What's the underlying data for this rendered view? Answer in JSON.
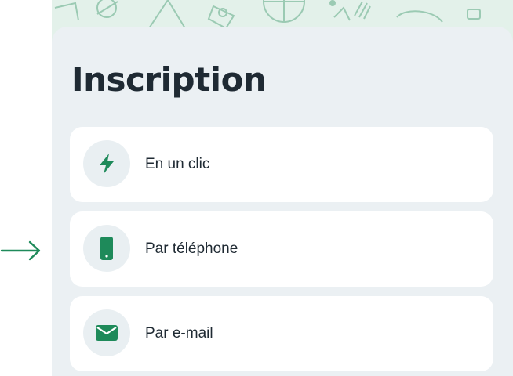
{
  "title": "Inscription",
  "options": [
    {
      "label": "En un clic",
      "icon": "lightning-icon"
    },
    {
      "label": "Par téléphone",
      "icon": "phone-icon"
    },
    {
      "label": "Par e-mail",
      "icon": "envelope-icon"
    }
  ],
  "colors": {
    "accent": "#1e8a5a",
    "panel_bg": "#ebf0f3",
    "card_bg": "#ffffff",
    "icon_circle": "#e9eff2",
    "text": "#1f2a33",
    "pattern_bg": "#e3f1ea"
  },
  "pointer": {
    "icon": "right-arrow-icon",
    "target": "option-phone"
  }
}
